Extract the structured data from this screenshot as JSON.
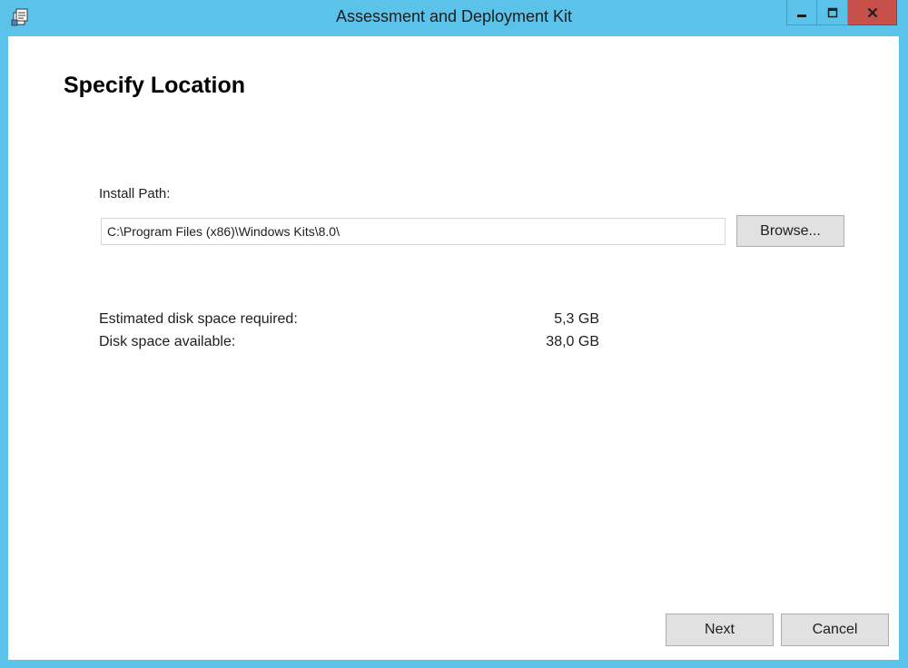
{
  "window": {
    "title": "Assessment and Deployment Kit",
    "icon": "installer-icon",
    "controls": {
      "minimize_icon": "minimize-icon",
      "maximize_icon": "maximize-icon",
      "close_icon": "close-icon"
    },
    "colors": {
      "frame": "#5bc2ea",
      "close_button": "#c7504b",
      "client_background": "#ffffff"
    }
  },
  "page": {
    "title": "Specify Location"
  },
  "install_path": {
    "label": "Install Path:",
    "value": "C:\\Program Files (x86)\\Windows Kits\\8.0\\",
    "browse_label": "Browse..."
  },
  "disk": {
    "required_label": "Estimated disk space required:",
    "required_value": "5,3 GB",
    "available_label": "Disk space available:",
    "available_value": "38,0 GB"
  },
  "footer": {
    "next_label": "Next",
    "cancel_label": "Cancel"
  }
}
